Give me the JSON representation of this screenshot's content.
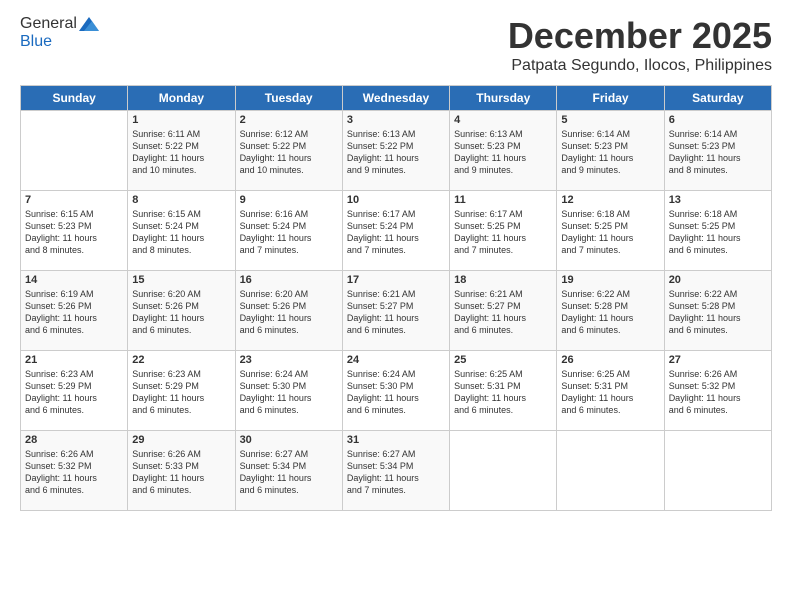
{
  "header": {
    "logo": {
      "general": "General",
      "blue": "Blue"
    },
    "title": "December 2025",
    "subtitle": "Patpata Segundo, Ilocos, Philippines"
  },
  "calendar": {
    "weekdays": [
      "Sunday",
      "Monday",
      "Tuesday",
      "Wednesday",
      "Thursday",
      "Friday",
      "Saturday"
    ],
    "weeks": [
      [
        {
          "day": "",
          "info": ""
        },
        {
          "day": "1",
          "info": "Sunrise: 6:11 AM\nSunset: 5:22 PM\nDaylight: 11 hours\nand 10 minutes."
        },
        {
          "day": "2",
          "info": "Sunrise: 6:12 AM\nSunset: 5:22 PM\nDaylight: 11 hours\nand 10 minutes."
        },
        {
          "day": "3",
          "info": "Sunrise: 6:13 AM\nSunset: 5:22 PM\nDaylight: 11 hours\nand 9 minutes."
        },
        {
          "day": "4",
          "info": "Sunrise: 6:13 AM\nSunset: 5:23 PM\nDaylight: 11 hours\nand 9 minutes."
        },
        {
          "day": "5",
          "info": "Sunrise: 6:14 AM\nSunset: 5:23 PM\nDaylight: 11 hours\nand 9 minutes."
        },
        {
          "day": "6",
          "info": "Sunrise: 6:14 AM\nSunset: 5:23 PM\nDaylight: 11 hours\nand 8 minutes."
        }
      ],
      [
        {
          "day": "7",
          "info": "Sunrise: 6:15 AM\nSunset: 5:23 PM\nDaylight: 11 hours\nand 8 minutes."
        },
        {
          "day": "8",
          "info": "Sunrise: 6:15 AM\nSunset: 5:24 PM\nDaylight: 11 hours\nand 8 minutes."
        },
        {
          "day": "9",
          "info": "Sunrise: 6:16 AM\nSunset: 5:24 PM\nDaylight: 11 hours\nand 7 minutes."
        },
        {
          "day": "10",
          "info": "Sunrise: 6:17 AM\nSunset: 5:24 PM\nDaylight: 11 hours\nand 7 minutes."
        },
        {
          "day": "11",
          "info": "Sunrise: 6:17 AM\nSunset: 5:25 PM\nDaylight: 11 hours\nand 7 minutes."
        },
        {
          "day": "12",
          "info": "Sunrise: 6:18 AM\nSunset: 5:25 PM\nDaylight: 11 hours\nand 7 minutes."
        },
        {
          "day": "13",
          "info": "Sunrise: 6:18 AM\nSunset: 5:25 PM\nDaylight: 11 hours\nand 6 minutes."
        }
      ],
      [
        {
          "day": "14",
          "info": "Sunrise: 6:19 AM\nSunset: 5:26 PM\nDaylight: 11 hours\nand 6 minutes."
        },
        {
          "day": "15",
          "info": "Sunrise: 6:20 AM\nSunset: 5:26 PM\nDaylight: 11 hours\nand 6 minutes."
        },
        {
          "day": "16",
          "info": "Sunrise: 6:20 AM\nSunset: 5:26 PM\nDaylight: 11 hours\nand 6 minutes."
        },
        {
          "day": "17",
          "info": "Sunrise: 6:21 AM\nSunset: 5:27 PM\nDaylight: 11 hours\nand 6 minutes."
        },
        {
          "day": "18",
          "info": "Sunrise: 6:21 AM\nSunset: 5:27 PM\nDaylight: 11 hours\nand 6 minutes."
        },
        {
          "day": "19",
          "info": "Sunrise: 6:22 AM\nSunset: 5:28 PM\nDaylight: 11 hours\nand 6 minutes."
        },
        {
          "day": "20",
          "info": "Sunrise: 6:22 AM\nSunset: 5:28 PM\nDaylight: 11 hours\nand 6 minutes."
        }
      ],
      [
        {
          "day": "21",
          "info": "Sunrise: 6:23 AM\nSunset: 5:29 PM\nDaylight: 11 hours\nand 6 minutes."
        },
        {
          "day": "22",
          "info": "Sunrise: 6:23 AM\nSunset: 5:29 PM\nDaylight: 11 hours\nand 6 minutes."
        },
        {
          "day": "23",
          "info": "Sunrise: 6:24 AM\nSunset: 5:30 PM\nDaylight: 11 hours\nand 6 minutes."
        },
        {
          "day": "24",
          "info": "Sunrise: 6:24 AM\nSunset: 5:30 PM\nDaylight: 11 hours\nand 6 minutes."
        },
        {
          "day": "25",
          "info": "Sunrise: 6:25 AM\nSunset: 5:31 PM\nDaylight: 11 hours\nand 6 minutes."
        },
        {
          "day": "26",
          "info": "Sunrise: 6:25 AM\nSunset: 5:31 PM\nDaylight: 11 hours\nand 6 minutes."
        },
        {
          "day": "27",
          "info": "Sunrise: 6:26 AM\nSunset: 5:32 PM\nDaylight: 11 hours\nand 6 minutes."
        }
      ],
      [
        {
          "day": "28",
          "info": "Sunrise: 6:26 AM\nSunset: 5:32 PM\nDaylight: 11 hours\nand 6 minutes."
        },
        {
          "day": "29",
          "info": "Sunrise: 6:26 AM\nSunset: 5:33 PM\nDaylight: 11 hours\nand 6 minutes."
        },
        {
          "day": "30",
          "info": "Sunrise: 6:27 AM\nSunset: 5:34 PM\nDaylight: 11 hours\nand 6 minutes."
        },
        {
          "day": "31",
          "info": "Sunrise: 6:27 AM\nSunset: 5:34 PM\nDaylight: 11 hours\nand 7 minutes."
        },
        {
          "day": "",
          "info": ""
        },
        {
          "day": "",
          "info": ""
        },
        {
          "day": "",
          "info": ""
        }
      ]
    ]
  }
}
